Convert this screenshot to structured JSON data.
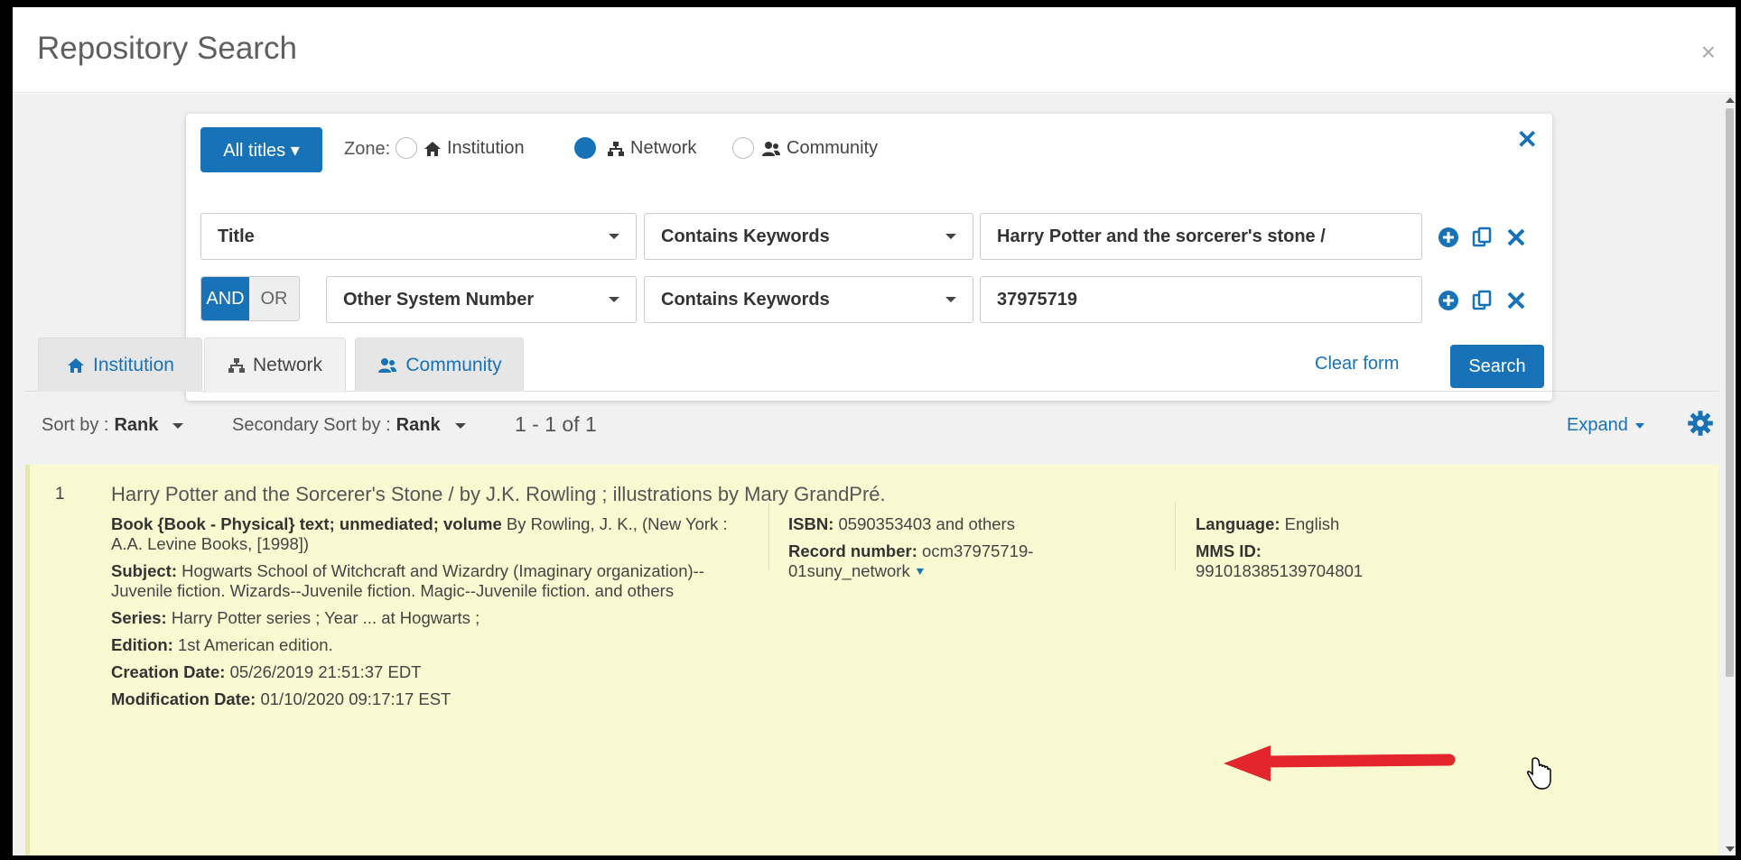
{
  "modal": {
    "title": "Repository Search",
    "close": "×"
  },
  "search": {
    "all_titles": "All titles ▾",
    "zone_label": "Zone:",
    "zones": [
      {
        "label": "Institution",
        "checked": false
      },
      {
        "label": "Network",
        "checked": true
      },
      {
        "label": "Community",
        "checked": false
      }
    ],
    "close": "✕",
    "rows": [
      {
        "field": "Title",
        "operator": "Contains Keywords",
        "value": "Harry Potter and the sorcerer's stone /"
      },
      {
        "field": "Other System Number",
        "operator": "Contains Keywords",
        "value": "37975719"
      }
    ],
    "and_label": "AND",
    "or_label": "OR",
    "clear_form": "Clear form",
    "search_button": "Search"
  },
  "tabs": [
    "Institution",
    "Network",
    "Community"
  ],
  "toolbar": {
    "sort_by_label": "Sort by :",
    "sort_by_value": "Rank",
    "secondary_sort_label": "Secondary Sort by :",
    "secondary_sort_value": "Rank",
    "count": "1 - 1 of 1",
    "expand": "Expand"
  },
  "result": {
    "number": "1",
    "title": "Harry Potter and the Sorcerer's Stone / by J.K. Rowling ; illustrations by Mary GrandPré.",
    "format_bold": "Book {Book - Physical} text; unmediated; volume",
    "format_rest": " By Rowling, J. K., (New York : A.A. Levine Books, [1998])",
    "subject_label": "Subject:",
    "subject": " Hogwarts School of Witchcraft and Wizardry (Imaginary organization)--Juvenile fiction. Wizards--Juvenile fiction. Magic--Juvenile fiction. and others",
    "series_label": "Series:",
    "series": " Harry Potter series ; Year ... at Hogwarts ;",
    "edition_label": "Edition:",
    "edition": " 1st American edition.",
    "creation_label": "Creation Date:",
    "creation": " 05/26/2019 21:51:37 EDT",
    "modification_label": "Modification Date:",
    "modification": " 01/10/2020 09:17:17 EST",
    "isbn_label": "ISBN:",
    "isbn": " 0590353403 and others",
    "record_label": "Record number:",
    "record": " ocm37975719-01suny_network",
    "language_label": "Language:",
    "language": " English",
    "mms_label": "MMS ID:",
    "mms": "991018385139704801"
  },
  "colors": {
    "primary": "#1872b7",
    "highlight": "#fafad2",
    "arrow": "#e3262b"
  }
}
